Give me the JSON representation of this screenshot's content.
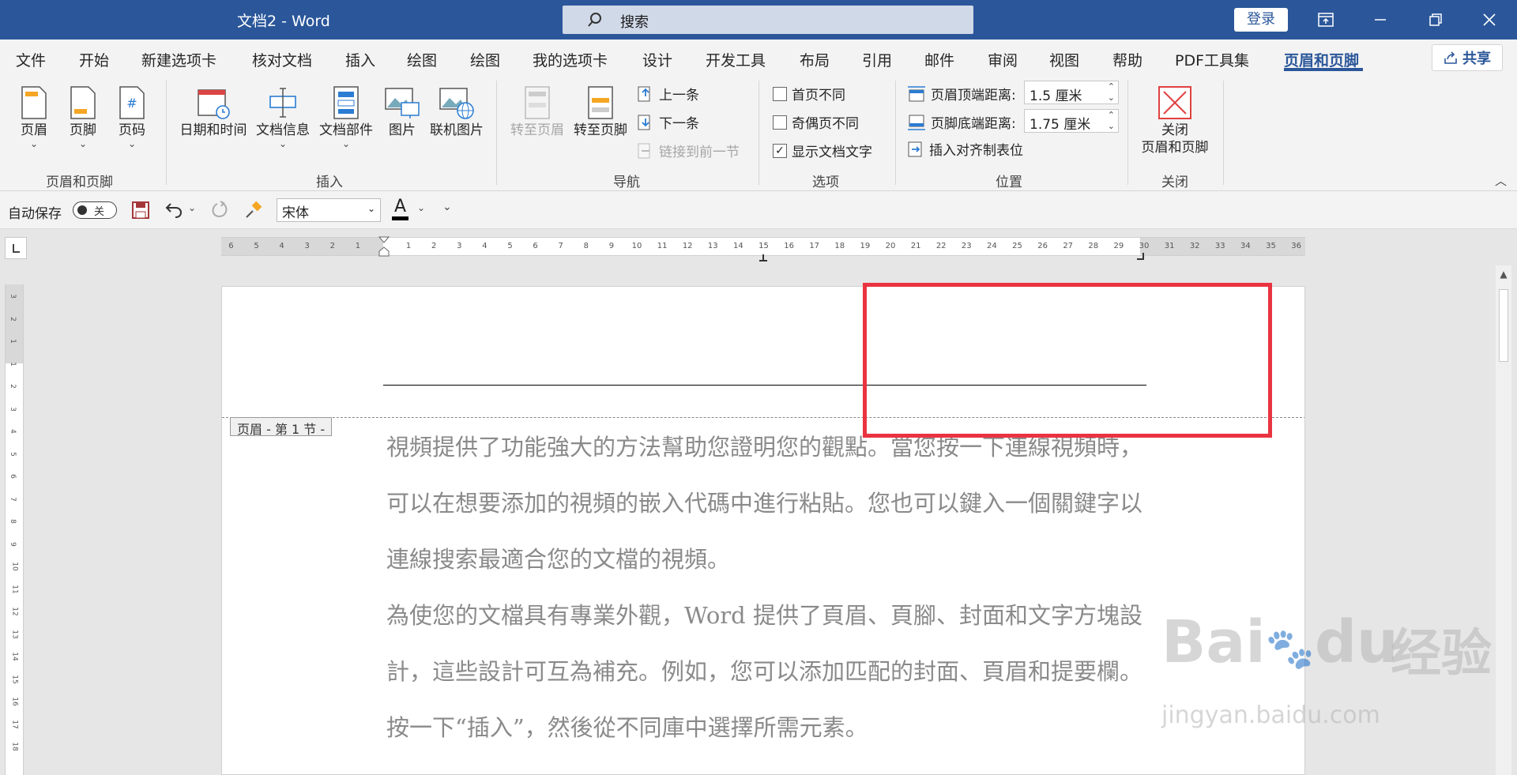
{
  "titlebar": {
    "doc_title": "文档2  -  Word",
    "search_placeholder": "搜索",
    "login_label": "登录"
  },
  "menu_tabs": [
    "文件",
    "开始",
    "新建选项卡",
    "核对文档",
    "插入",
    "绘图",
    "绘图",
    "我的选项卡",
    "设计",
    "开发工具",
    "布局",
    "引用",
    "邮件",
    "审阅",
    "视图",
    "帮助",
    "PDF工具集",
    "页眉和页脚"
  ],
  "active_tab": "页眉和页脚",
  "share_label": "共享",
  "ribbon": {
    "header_footer_group": {
      "label": "页眉和页脚",
      "header": "页眉",
      "footer": "页脚",
      "page_number": "页码"
    },
    "insert_group": {
      "label": "插入",
      "datetime": "日期和时间",
      "docinfo": "文档信息",
      "quickparts": "文档部件",
      "picture": "图片",
      "online_picture": "联机图片"
    },
    "nav_group": {
      "label": "导航",
      "goto_header": "转至页眉",
      "goto_footer": "转至页脚",
      "previous": "上一条",
      "next": "下一条",
      "link_previous": "链接到前一节"
    },
    "options_group": {
      "label": "选项",
      "diff_first": "首页不同",
      "diff_odd_even": "奇偶页不同",
      "show_doc_text": "显示文档文字",
      "diff_first_checked": false,
      "diff_odd_even_checked": false,
      "show_doc_text_checked": true
    },
    "position_group": {
      "label": "位置",
      "header_top_label": "页眉顶端距离:",
      "header_top_value": "1.5 厘米",
      "footer_bottom_label": "页脚底端距离:",
      "footer_bottom_value": "1.75 厘米",
      "insert_align_tab": "插入对齐制表位"
    },
    "close_group": {
      "label": "关闭",
      "close_line1": "关闭",
      "close_line2": "页眉和页脚"
    }
  },
  "qat": {
    "autosave_label": "自动保存",
    "autosave_state": "关",
    "font_name": "宋体",
    "font_color_letter": "A"
  },
  "ruler": {
    "left_numbers": [
      "6",
      "5",
      "4",
      "3",
      "2",
      "1"
    ],
    "right_numbers": [
      "1",
      "2",
      "3",
      "4",
      "5",
      "6",
      "7",
      "8",
      "9",
      "10",
      "11",
      "12",
      "13",
      "14",
      "15",
      "16",
      "17",
      "18",
      "19",
      "20",
      "21",
      "22",
      "23",
      "24",
      "25",
      "26",
      "27",
      "28",
      "29",
      "30",
      "31",
      "32",
      "33",
      "34",
      "35",
      "36"
    ],
    "vertical_numbers": [
      "3",
      "2",
      "1",
      "1",
      "2",
      "3",
      "4",
      "5",
      "6",
      "7",
      "8",
      "9",
      "10",
      "11",
      "12",
      "13",
      "14",
      "15",
      "16",
      "17",
      "18"
    ]
  },
  "document": {
    "header_tag": "页眉 - 第 1 节 -",
    "paragraph1": "視頻提供了功能強大的方法幫助您證明您的觀點。當您按一下連線視頻時，可以在想要添加的視頻的嵌入代碼中進行粘貼。您也可以鍵入一個關鍵字以連線搜索最適合您的文檔的視頻。",
    "paragraph2": "為使您的文檔具有專業外觀，Word 提供了頁眉、頁腳、封面和文字方塊設計，這些設計可互為補充。例如，您可以添加匹配的封面、頁眉和提要欄。按一下“插入”，然後從不同庫中選擇所需元素。"
  },
  "watermark": {
    "logo": "Bai",
    "logo2": "du",
    "logo_cn": "经验",
    "url": "jingyan.baidu.com"
  },
  "colors": {
    "title_bar": "#2b579a",
    "accent": "#2b579a",
    "highlight": "#ea3340",
    "body_text": "#8a8a8a"
  }
}
